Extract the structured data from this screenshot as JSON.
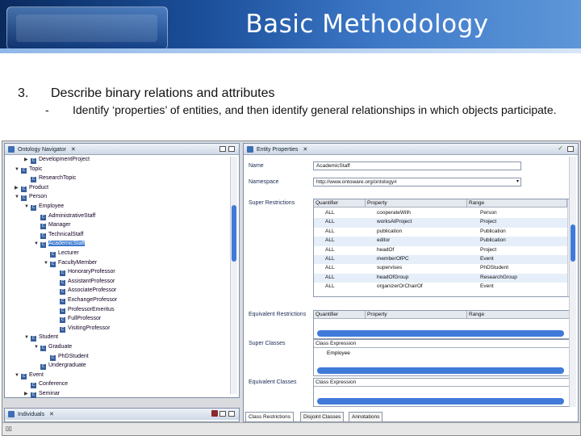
{
  "slide": {
    "title": "Basic Methodology",
    "point_number": "3.",
    "point_text": "Describe binary relations and attributes",
    "sub_dash": "-",
    "sub_text": "Identify ‘properties’ of entities, and then identify general relationships in which objects participate."
  },
  "navigator": {
    "title": "Ontology Navigator",
    "tree": [
      {
        "label": "DevelopmentProject",
        "depth": 1,
        "arrow": "right"
      },
      {
        "label": "Topic",
        "depth": 0,
        "arrow": "down"
      },
      {
        "label": "ResearchTopic",
        "depth": 1,
        "arrow": ""
      },
      {
        "label": "Product",
        "depth": 0,
        "arrow": "right"
      },
      {
        "label": "Person",
        "depth": 0,
        "arrow": "down"
      },
      {
        "label": "Employee",
        "depth": 1,
        "arrow": "down"
      },
      {
        "label": "AdministrativeStaff",
        "depth": 2,
        "arrow": ""
      },
      {
        "label": "Manager",
        "depth": 2,
        "arrow": ""
      },
      {
        "label": "TechnicalStaff",
        "depth": 2,
        "arrow": ""
      },
      {
        "label": "AcademicStaff",
        "depth": 2,
        "arrow": "down",
        "selected": true
      },
      {
        "label": "Lecturer",
        "depth": 3,
        "arrow": ""
      },
      {
        "label": "FacultyMember",
        "depth": 3,
        "arrow": "down"
      },
      {
        "label": "HonoraryProfessor",
        "depth": 4,
        "arrow": ""
      },
      {
        "label": "AssistantProfessor",
        "depth": 4,
        "arrow": ""
      },
      {
        "label": "AssociateProfessor",
        "depth": 4,
        "arrow": ""
      },
      {
        "label": "ExchangeProfessor",
        "depth": 4,
        "arrow": ""
      },
      {
        "label": "ProfessorEmeritus",
        "depth": 4,
        "arrow": ""
      },
      {
        "label": "FullProfessor",
        "depth": 4,
        "arrow": ""
      },
      {
        "label": "VisitingProfessor",
        "depth": 4,
        "arrow": ""
      },
      {
        "label": "Student",
        "depth": 1,
        "arrow": "down"
      },
      {
        "label": "Graduate",
        "depth": 2,
        "arrow": "down"
      },
      {
        "label": "PhDStudent",
        "depth": 3,
        "arrow": ""
      },
      {
        "label": "Undergraduate",
        "depth": 2,
        "arrow": ""
      },
      {
        "label": "Event",
        "depth": 0,
        "arrow": "down"
      },
      {
        "label": "Conference",
        "depth": 1,
        "arrow": ""
      },
      {
        "label": "Seminar",
        "depth": 1,
        "arrow": "right"
      }
    ]
  },
  "individuals": {
    "title": "Individuals"
  },
  "entity": {
    "title": "Entity Properties",
    "name_label": "Name",
    "name_value": "AcademicStaff",
    "namespace_label": "Namespace",
    "namespace_value": "http://www.ontoware.org/ontology#",
    "super_restrictions_label": "Super Restrictions",
    "columns": [
      "Quantifier",
      "Property",
      "Range"
    ],
    "rows": [
      {
        "q": "ALL",
        "p": "cooperateWith",
        "r": "Person"
      },
      {
        "q": "ALL",
        "p": "worksAtProject",
        "r": "Project"
      },
      {
        "q": "ALL",
        "p": "publication",
        "r": "Publication"
      },
      {
        "q": "ALL",
        "p": "editor",
        "r": "Publication"
      },
      {
        "q": "ALL",
        "p": "headOf",
        "r": "Project"
      },
      {
        "q": "ALL",
        "p": "memberOfPC",
        "r": "Event"
      },
      {
        "q": "ALL",
        "p": "supervises",
        "r": "PhDStudent"
      },
      {
        "q": "ALL",
        "p": "headOfGroup",
        "r": "ResearchGroup"
      },
      {
        "q": "ALL",
        "p": "organizerOrChairOf",
        "r": "Event"
      }
    ],
    "equiv_restrictions_label": "Equivalent Restrictions",
    "super_classes_label": "Super Classes",
    "class_expression_header": "Class Expression",
    "super_class_value": "Employee",
    "equiv_classes_label": "Equivalent Classes",
    "equiv_class_expression_header": "Class Expression",
    "tabs": [
      "Class Restrictions",
      "Disjoint Classes",
      "Annotations"
    ]
  },
  "status": {
    "left_text": "▯▯"
  }
}
